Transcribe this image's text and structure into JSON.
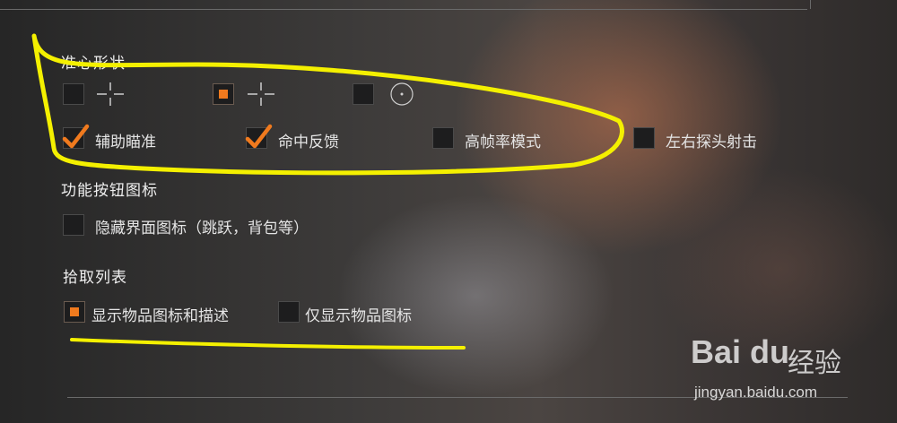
{
  "crosshair": {
    "title": "准心形状",
    "shapes": [
      {
        "icon": "crosshair-cross-icon",
        "selected": false
      },
      {
        "icon": "crosshair-cross-icon",
        "selected": true
      },
      {
        "icon": "crosshair-dot-circle-icon",
        "selected": false
      }
    ],
    "options": [
      {
        "label": "辅助瞄准",
        "checked": true
      },
      {
        "label": "命中反馈",
        "checked": true
      },
      {
        "label": "高帧率模式",
        "checked": false
      },
      {
        "label": "左右探头射击",
        "checked": false
      }
    ]
  },
  "function_buttons": {
    "title": "功能按钮图标",
    "options": [
      {
        "label": "隐藏界面图标（跳跃，背包等）",
        "checked": false
      }
    ]
  },
  "pickup": {
    "title": "拾取列表",
    "options": [
      {
        "label": "显示物品图标和描述",
        "selected": true
      },
      {
        "label": "仅显示物品图标",
        "selected": false
      }
    ]
  },
  "watermark": {
    "logo": "Bai du",
    "cn": "经验",
    "url": "jingyan.baidu.com"
  },
  "colors": {
    "accent_orange": "#f07a1e",
    "annotation_yellow": "#f4f000",
    "checkbox_bg": "#1d1d1e"
  }
}
